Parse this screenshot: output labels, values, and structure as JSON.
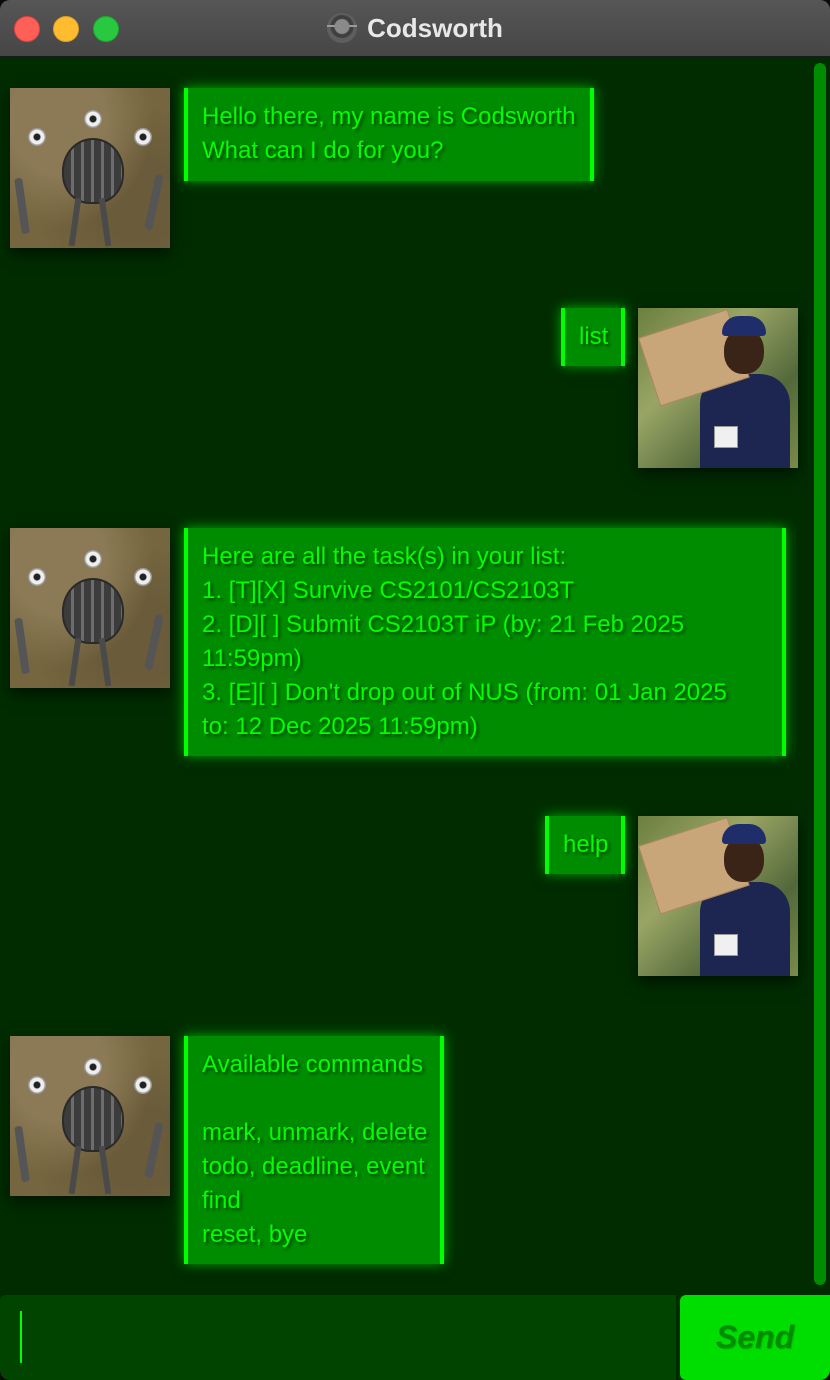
{
  "window": {
    "title": "Codsworth",
    "title_icon": "codsworth-robot-icon"
  },
  "messages": [
    {
      "sender": "bot",
      "text": "Hello there, my name is Codsworth\nWhat can I do for you?"
    },
    {
      "sender": "user",
      "text": "list"
    },
    {
      "sender": "bot",
      "text": "Here are all the task(s) in your list:\n1. [T][X] Survive CS2101/CS2103T\n2. [D][ ] Submit CS2103T iP (by: 21 Feb 2025\n11:59pm)\n3. [E][ ] Don't drop out of NUS (from: 01 Jan 2025\nto: 12 Dec 2025 11:59pm)"
    },
    {
      "sender": "user",
      "text": "help"
    },
    {
      "sender": "bot",
      "text": "Available commands\n\nmark, unmark, delete\ntodo, deadline, event\nfind\nreset, bye"
    }
  ],
  "input": {
    "value": "",
    "placeholder": ""
  },
  "send_button": {
    "label": "Send"
  },
  "colors": {
    "background": "#002c00",
    "bubble_fill": "#008c00",
    "bubble_text": "#00ff00",
    "send_button": "#00dd00"
  }
}
